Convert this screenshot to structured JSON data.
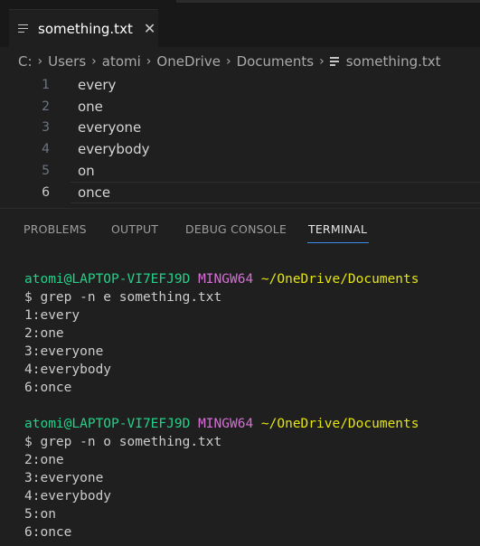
{
  "tab": {
    "label": "something.txt",
    "close": "✕"
  },
  "breadcrumb": {
    "items": [
      "C:",
      "Users",
      "atomi",
      "OneDrive",
      "Documents"
    ],
    "file": "something.txt",
    "separator": "›"
  },
  "editor": {
    "lines": [
      {
        "num": "1",
        "text": "every"
      },
      {
        "num": "2",
        "text": "one"
      },
      {
        "num": "3",
        "text": "everyone"
      },
      {
        "num": "4",
        "text": "everybody"
      },
      {
        "num": "5",
        "text": "on"
      },
      {
        "num": "6",
        "text": "once"
      }
    ]
  },
  "panel": {
    "tabs": [
      "PROBLEMS",
      "OUTPUT",
      "DEBUG CONSOLE",
      "TERMINAL"
    ],
    "active": "TERMINAL"
  },
  "terminal": {
    "blocks": [
      {
        "user": "atomi@LAPTOP-VI7EFJ9D",
        "env": "MINGW64",
        "path": "~/OneDrive/Documents",
        "command": "$ grep -n e something.txt",
        "output": [
          "1:every",
          "2:one",
          "3:everyone",
          "4:everybody",
          "6:once"
        ]
      },
      {
        "user": "atomi@LAPTOP-VI7EFJ9D",
        "env": "MINGW64",
        "path": "~/OneDrive/Documents",
        "command": "$ grep -n o something.txt",
        "output": [
          "2:one",
          "3:everyone",
          "4:everybody",
          "5:on",
          "6:once"
        ]
      }
    ]
  },
  "colors": {
    "prompt_user": "#23d18b",
    "prompt_env": "#d670d6",
    "prompt_path": "#e5e510",
    "panel_active_underline": "#3b8eea"
  }
}
